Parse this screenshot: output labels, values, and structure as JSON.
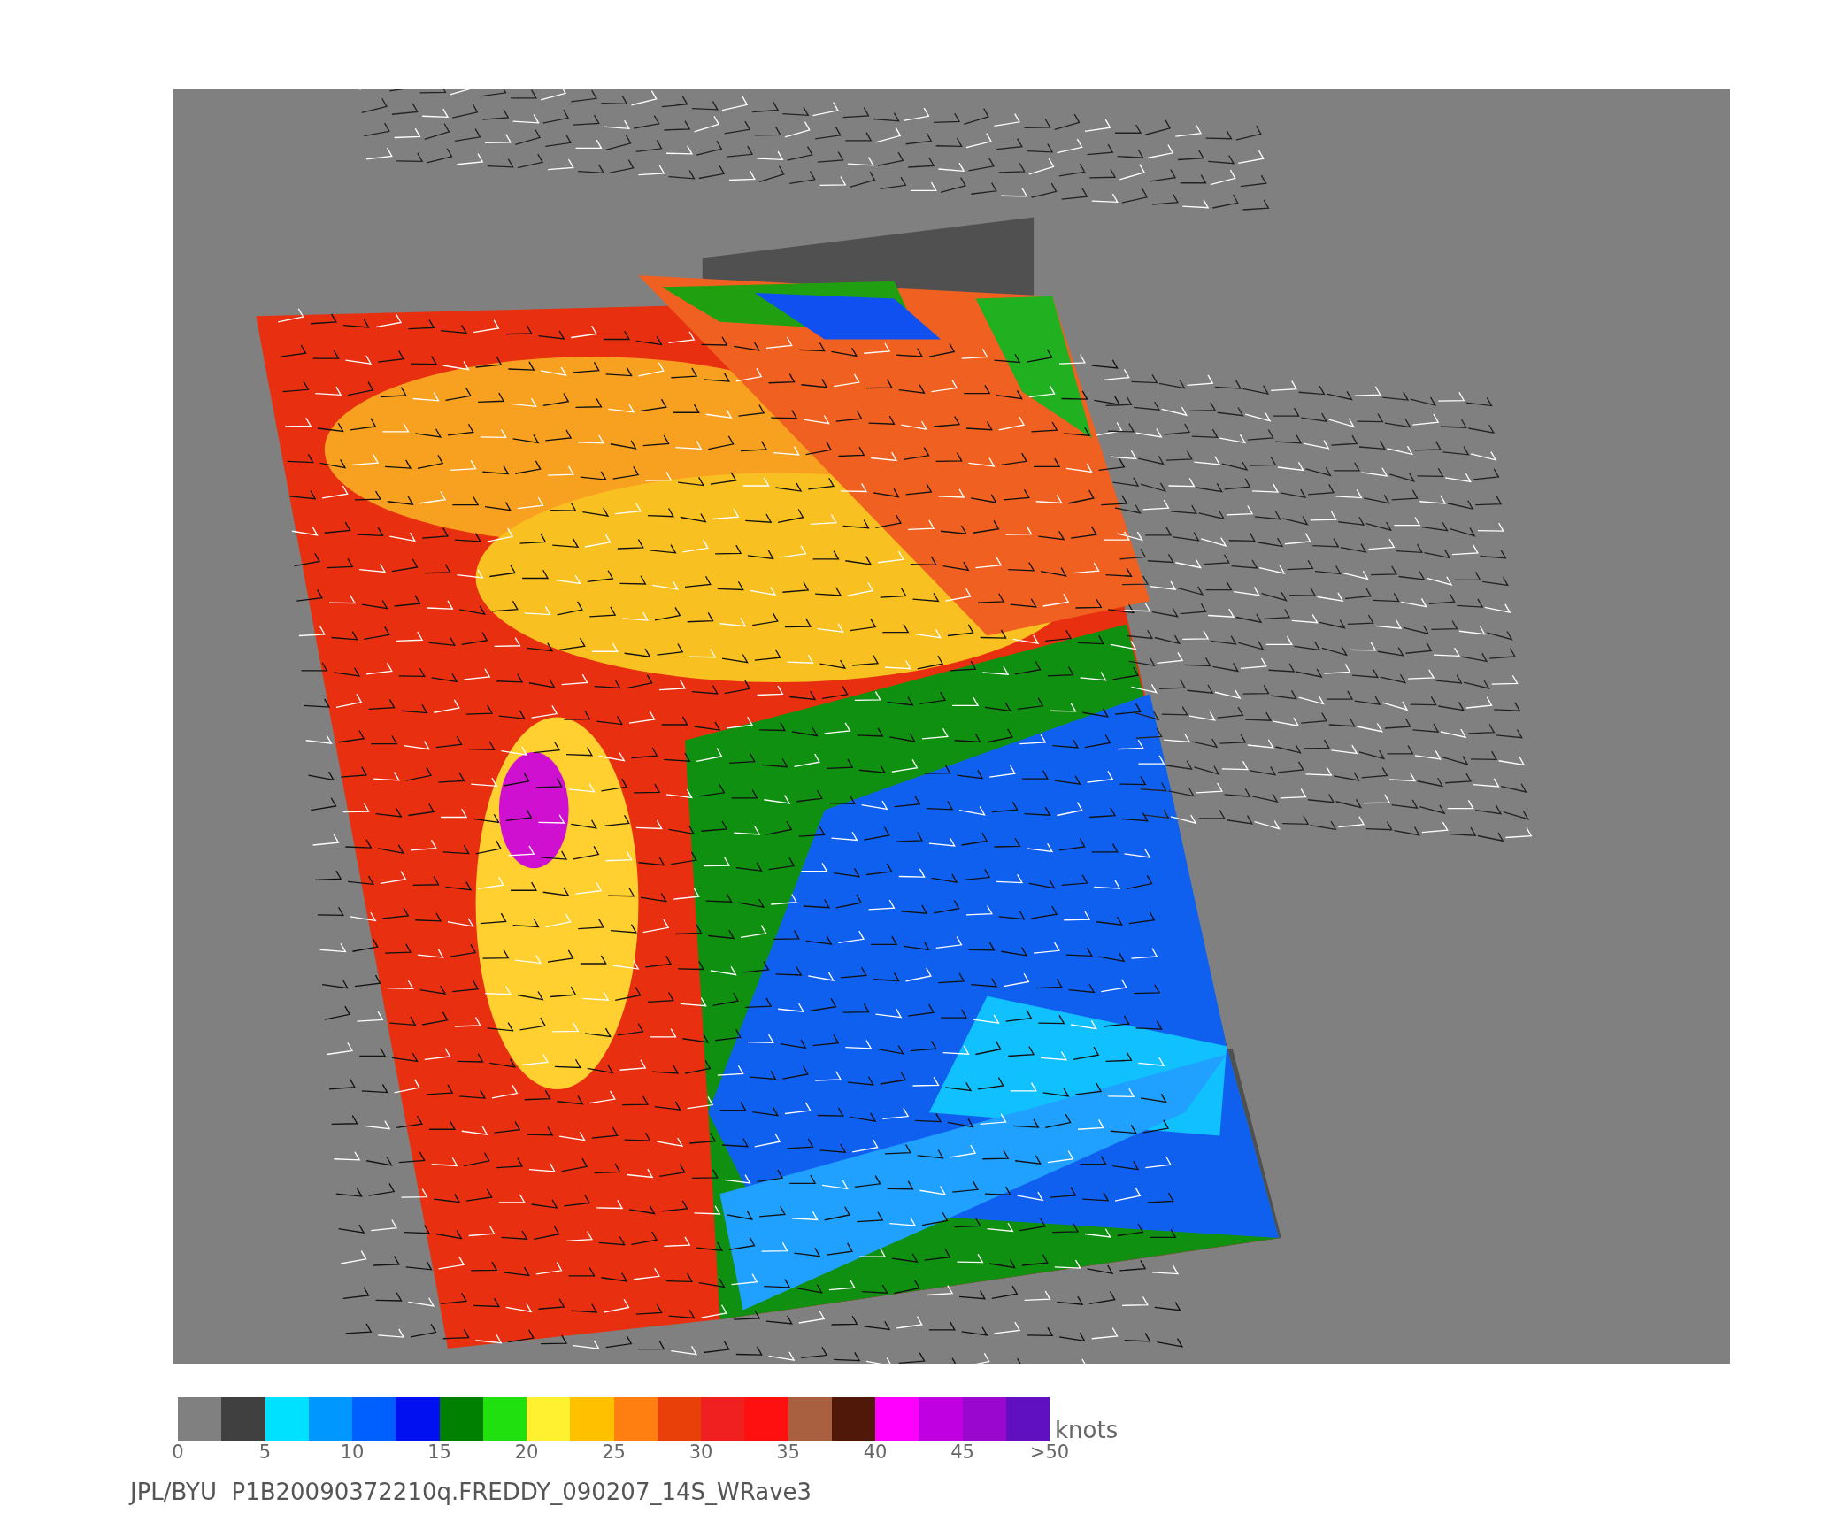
{
  "colorbar": {
    "segments": [
      {
        "color": "#808080"
      },
      {
        "color": "#404040"
      },
      {
        "color": "#00e0ff"
      },
      {
        "color": "#0098ff"
      },
      {
        "color": "#0060ff"
      },
      {
        "color": "#0010f0"
      },
      {
        "color": "#008000"
      },
      {
        "color": "#20e010"
      },
      {
        "color": "#fff030"
      },
      {
        "color": "#ffc000"
      },
      {
        "color": "#ff8010"
      },
      {
        "color": "#e84008"
      },
      {
        "color": "#f02020"
      },
      {
        "color": "#ff1010"
      },
      {
        "color": "#a86040"
      },
      {
        "color": "#501808"
      },
      {
        "color": "#ff00ff"
      },
      {
        "color": "#c000e0"
      },
      {
        "color": "#9a08d0"
      },
      {
        "color": "#6010c0"
      }
    ],
    "ticks": [
      "0",
      "5",
      "10",
      "15",
      "20",
      "25",
      "30",
      "35",
      "40",
      "45",
      ">50"
    ],
    "unit": "knots"
  },
  "caption": "JPL/BYU  P1B20090372210q.FREDDY_090207_14S_WRave3"
}
